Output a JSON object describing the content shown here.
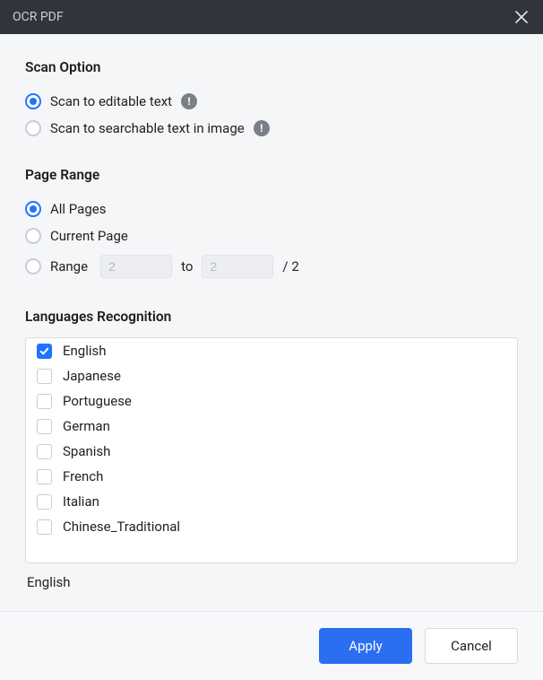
{
  "modal": {
    "title": "OCR PDF"
  },
  "scan_option": {
    "heading": "Scan Option",
    "options": [
      {
        "label": "Scan to editable text",
        "checked": true,
        "info": true
      },
      {
        "label": "Scan to searchable text in image",
        "checked": false,
        "info": true
      }
    ]
  },
  "page_range": {
    "heading": "Page Range",
    "all_pages": {
      "label": "All Pages",
      "checked": true
    },
    "current_page": {
      "label": "Current Page",
      "checked": false
    },
    "range": {
      "label": "Range",
      "checked": false,
      "from": "2",
      "to_label": "to",
      "to": "2",
      "total_label": "/ 2"
    }
  },
  "languages": {
    "heading": "Languages Recognition",
    "items": [
      {
        "label": "English",
        "checked": true
      },
      {
        "label": "Japanese",
        "checked": false
      },
      {
        "label": "Portuguese",
        "checked": false
      },
      {
        "label": "German",
        "checked": false
      },
      {
        "label": "Spanish",
        "checked": false
      },
      {
        "label": "French",
        "checked": false
      },
      {
        "label": "Italian",
        "checked": false
      },
      {
        "label": "Chinese_Traditional",
        "checked": false
      }
    ],
    "selected_summary": "English"
  },
  "footer": {
    "apply": "Apply",
    "cancel": "Cancel"
  },
  "info_glyph": "!"
}
